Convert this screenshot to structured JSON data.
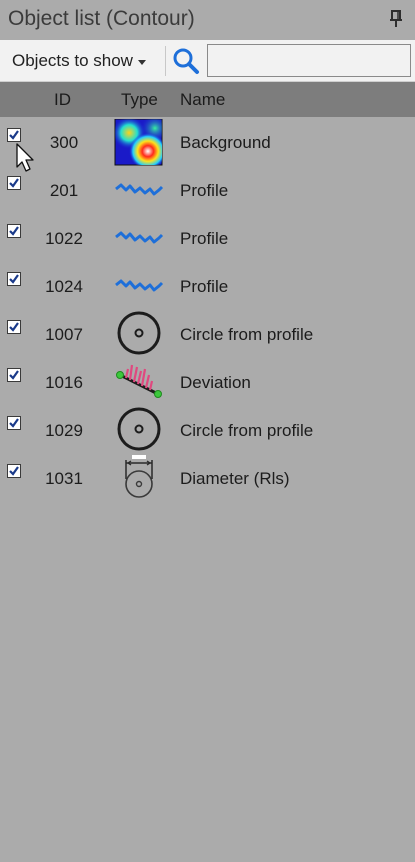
{
  "title": "Object list (Contour)",
  "toolbar": {
    "filter_label": "Objects to show",
    "search_placeholder": "",
    "search_value": ""
  },
  "columns": {
    "id": "ID",
    "type": "Type",
    "name": "Name"
  },
  "rows": [
    {
      "checked": true,
      "id": "300",
      "icon": "heatmap-icon",
      "name": "Background"
    },
    {
      "checked": true,
      "id": "201",
      "icon": "profile-wave-icon",
      "name": "Profile"
    },
    {
      "checked": true,
      "id": "1022",
      "icon": "profile-wave-icon",
      "name": "Profile"
    },
    {
      "checked": true,
      "id": "1024",
      "icon": "profile-wave-icon",
      "name": "Profile"
    },
    {
      "checked": true,
      "id": "1007",
      "icon": "circle-icon",
      "name": "Circle from profile"
    },
    {
      "checked": true,
      "id": "1016",
      "icon": "deviation-icon",
      "name": "Deviation"
    },
    {
      "checked": true,
      "id": "1029",
      "icon": "circle-icon",
      "name": "Circle from profile"
    },
    {
      "checked": true,
      "id": "1031",
      "icon": "diameter-icon",
      "name": "Diameter (Rls)"
    }
  ],
  "colors": {
    "panel_bg": "#ababab",
    "header_bg": "#7d7d7d",
    "toolbar_bg": "#f2f2f2",
    "accent_blue": "#1e6fd9",
    "deviation_pink": "#e0487f",
    "deviation_green": "#3cc83c"
  }
}
